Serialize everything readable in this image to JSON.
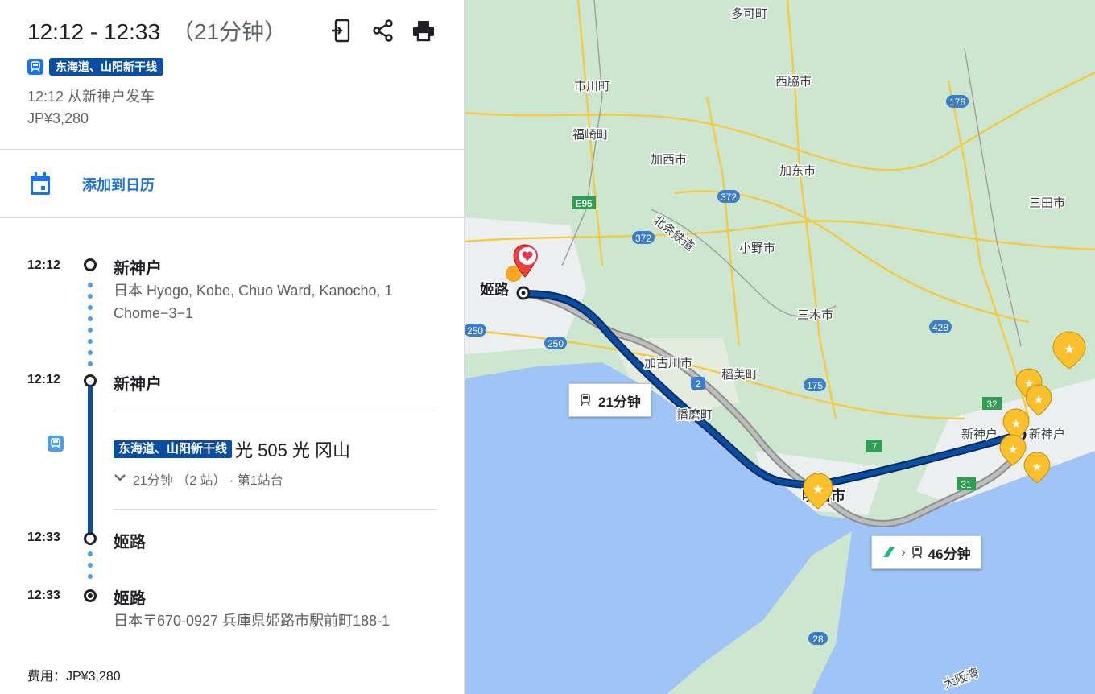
{
  "summary": {
    "time_range": "12:12 - 12:33",
    "duration": "（21分钟）",
    "line_name": "东海道、山阳新干线",
    "depart_text": "12:12 从新神户发车",
    "price": "JP¥3,280"
  },
  "calendar": {
    "label": "添加到日历"
  },
  "timeline": {
    "stops": [
      {
        "time": "12:12",
        "name": "新神户",
        "address": "日本 Hyogo, Kobe, Chuo Ward, Kanocho, 1 Chome−3−1"
      },
      {
        "time": "12:12",
        "name": "新神户"
      },
      {
        "time": "12:33",
        "name": "姬路"
      },
      {
        "time": "12:33",
        "name": "姬路",
        "address": "日本〒670-0927 兵庫県姫路市駅前町188-1"
      }
    ],
    "trip": {
      "line": "东海道、山阳新干线",
      "train": "光 505 光 冈山",
      "detail": "21分钟 （2 站） · 第1站台"
    }
  },
  "fare": "费用：JP¥3,280",
  "map": {
    "route_primary_label": "21分钟",
    "route_alt_label": "46分钟",
    "places": {
      "himeji": "姬路",
      "shinkobe_a": "新神户",
      "shinkobe_b": "新神户",
      "akashi": "明石市",
      "takasago": "播磨町",
      "kakogawa": "加古川市",
      "inami": "稻美町",
      "miki": "三木市",
      "ono": "小野市",
      "kasai": "加西市",
      "kato": "加东市",
      "nishiwaki": "西脇市",
      "taka": "多可町",
      "ichikawa": "市川町",
      "fukusaki": "福崎町",
      "sanda": "三田市",
      "hojo": "北条鉄道",
      "osaka_bay": "大阪湾"
    },
    "road_shields": [
      "E95",
      "372",
      "372",
      "176",
      "428",
      "175",
      "250",
      "250",
      "2",
      "7",
      "32",
      "31",
      "28"
    ]
  },
  "colors": {
    "accent": "#1a73e8",
    "line_badge": "#0a4ea3",
    "route": "#0a4ea3",
    "water": "#9fc4f5",
    "land": "#cde6cf"
  }
}
